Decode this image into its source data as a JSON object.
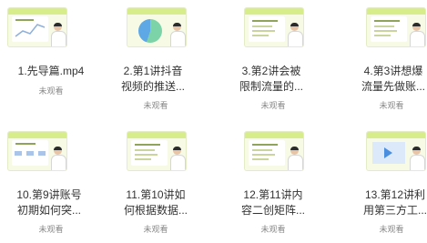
{
  "videos": [
    {
      "title_line1": "1.先导篇.mp4",
      "title_line2": "",
      "status": "未观看",
      "thumb_style": "chart"
    },
    {
      "title_line1": "2.第1讲抖音",
      "title_line2": "视频的推送...",
      "status": "未观看",
      "thumb_style": "pie"
    },
    {
      "title_line1": "3.第2讲会被",
      "title_line2": "限制流量的...",
      "status": "未观看",
      "thumb_style": "list"
    },
    {
      "title_line1": "4.第3讲想爆",
      "title_line2": "流量先做账...",
      "status": "未观看",
      "thumb_style": "list"
    },
    {
      "title_line1": "10.第9讲账号",
      "title_line2": "初期如何突...",
      "status": "未观看",
      "thumb_style": "flow"
    },
    {
      "title_line1": "11.第10讲如",
      "title_line2": "何根据数据...",
      "status": "未观看",
      "thumb_style": "list"
    },
    {
      "title_line1": "12.第11讲内",
      "title_line2": "容二创矩阵...",
      "status": "未观看",
      "thumb_style": "list"
    },
    {
      "title_line1": "13.第12讲利",
      "title_line2": "用第三方工...",
      "status": "未观看",
      "thumb_style": "video"
    }
  ],
  "colors": {
    "thumb_band": "#d7ec8a",
    "title": "#333333",
    "status": "#888888"
  }
}
